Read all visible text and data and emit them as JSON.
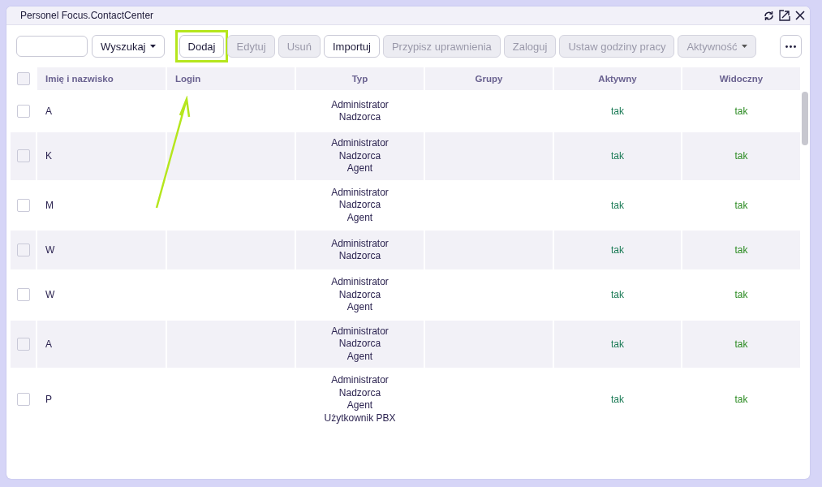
{
  "window": {
    "title": "Personel Focus.ContactCenter"
  },
  "toolbar": {
    "buttons": [
      {
        "label": "Wyszukaj",
        "kind": "dropdown",
        "disabled": false,
        "highlighted": false
      },
      {
        "label": "Dodaj",
        "kind": "button",
        "disabled": false,
        "highlighted": true
      },
      {
        "label": "Edytuj",
        "kind": "button",
        "disabled": true,
        "highlighted": false
      },
      {
        "label": "Usuń",
        "kind": "button",
        "disabled": true,
        "highlighted": false
      },
      {
        "label": "Importuj",
        "kind": "button",
        "disabled": false,
        "highlighted": false
      },
      {
        "label": "Przypisz uprawnienia",
        "kind": "button",
        "disabled": true,
        "highlighted": false
      },
      {
        "label": "Zaloguj",
        "kind": "button",
        "disabled": true,
        "highlighted": false
      },
      {
        "label": "Ustaw godziny pracy",
        "kind": "button",
        "disabled": true,
        "highlighted": false
      },
      {
        "label": "Aktywność",
        "kind": "dropdown",
        "disabled": true,
        "highlighted": false
      }
    ]
  },
  "table": {
    "select_all_checked": false,
    "columns": [
      "Imię i nazwisko",
      "Login",
      "Typ",
      "Grupy",
      "Aktywny",
      "Widoczny"
    ],
    "rows": [
      {
        "checked": false,
        "name": "A",
        "types": [
          "Administrator",
          "Nadzorca"
        ],
        "active": "tak",
        "visible": "tak"
      },
      {
        "checked": false,
        "name": "K",
        "types": [
          "Administrator",
          "Nadzorca",
          "Agent"
        ],
        "active": "tak",
        "visible": "tak"
      },
      {
        "checked": false,
        "name": "M",
        "types": [
          "Administrator",
          "Nadzorca",
          "Agent"
        ],
        "active": "tak",
        "visible": "tak"
      },
      {
        "checked": false,
        "name": "W",
        "types": [
          "Administrator",
          "Nadzorca"
        ],
        "active": "tak",
        "visible": "tak"
      },
      {
        "checked": false,
        "name": "W",
        "types": [
          "Administrator",
          "Nadzorca",
          "Agent"
        ],
        "active": "tak",
        "visible": "tak"
      },
      {
        "checked": false,
        "name": "A",
        "types": [
          "Administrator",
          "Nadzorca",
          "Agent"
        ],
        "active": "tak",
        "visible": "tak"
      },
      {
        "checked": false,
        "name": "P",
        "types": [
          "Administrator",
          "Nadzorca",
          "Agent",
          "Użytkownik PBX"
        ],
        "active": "tak",
        "visible": "tak"
      }
    ]
  }
}
